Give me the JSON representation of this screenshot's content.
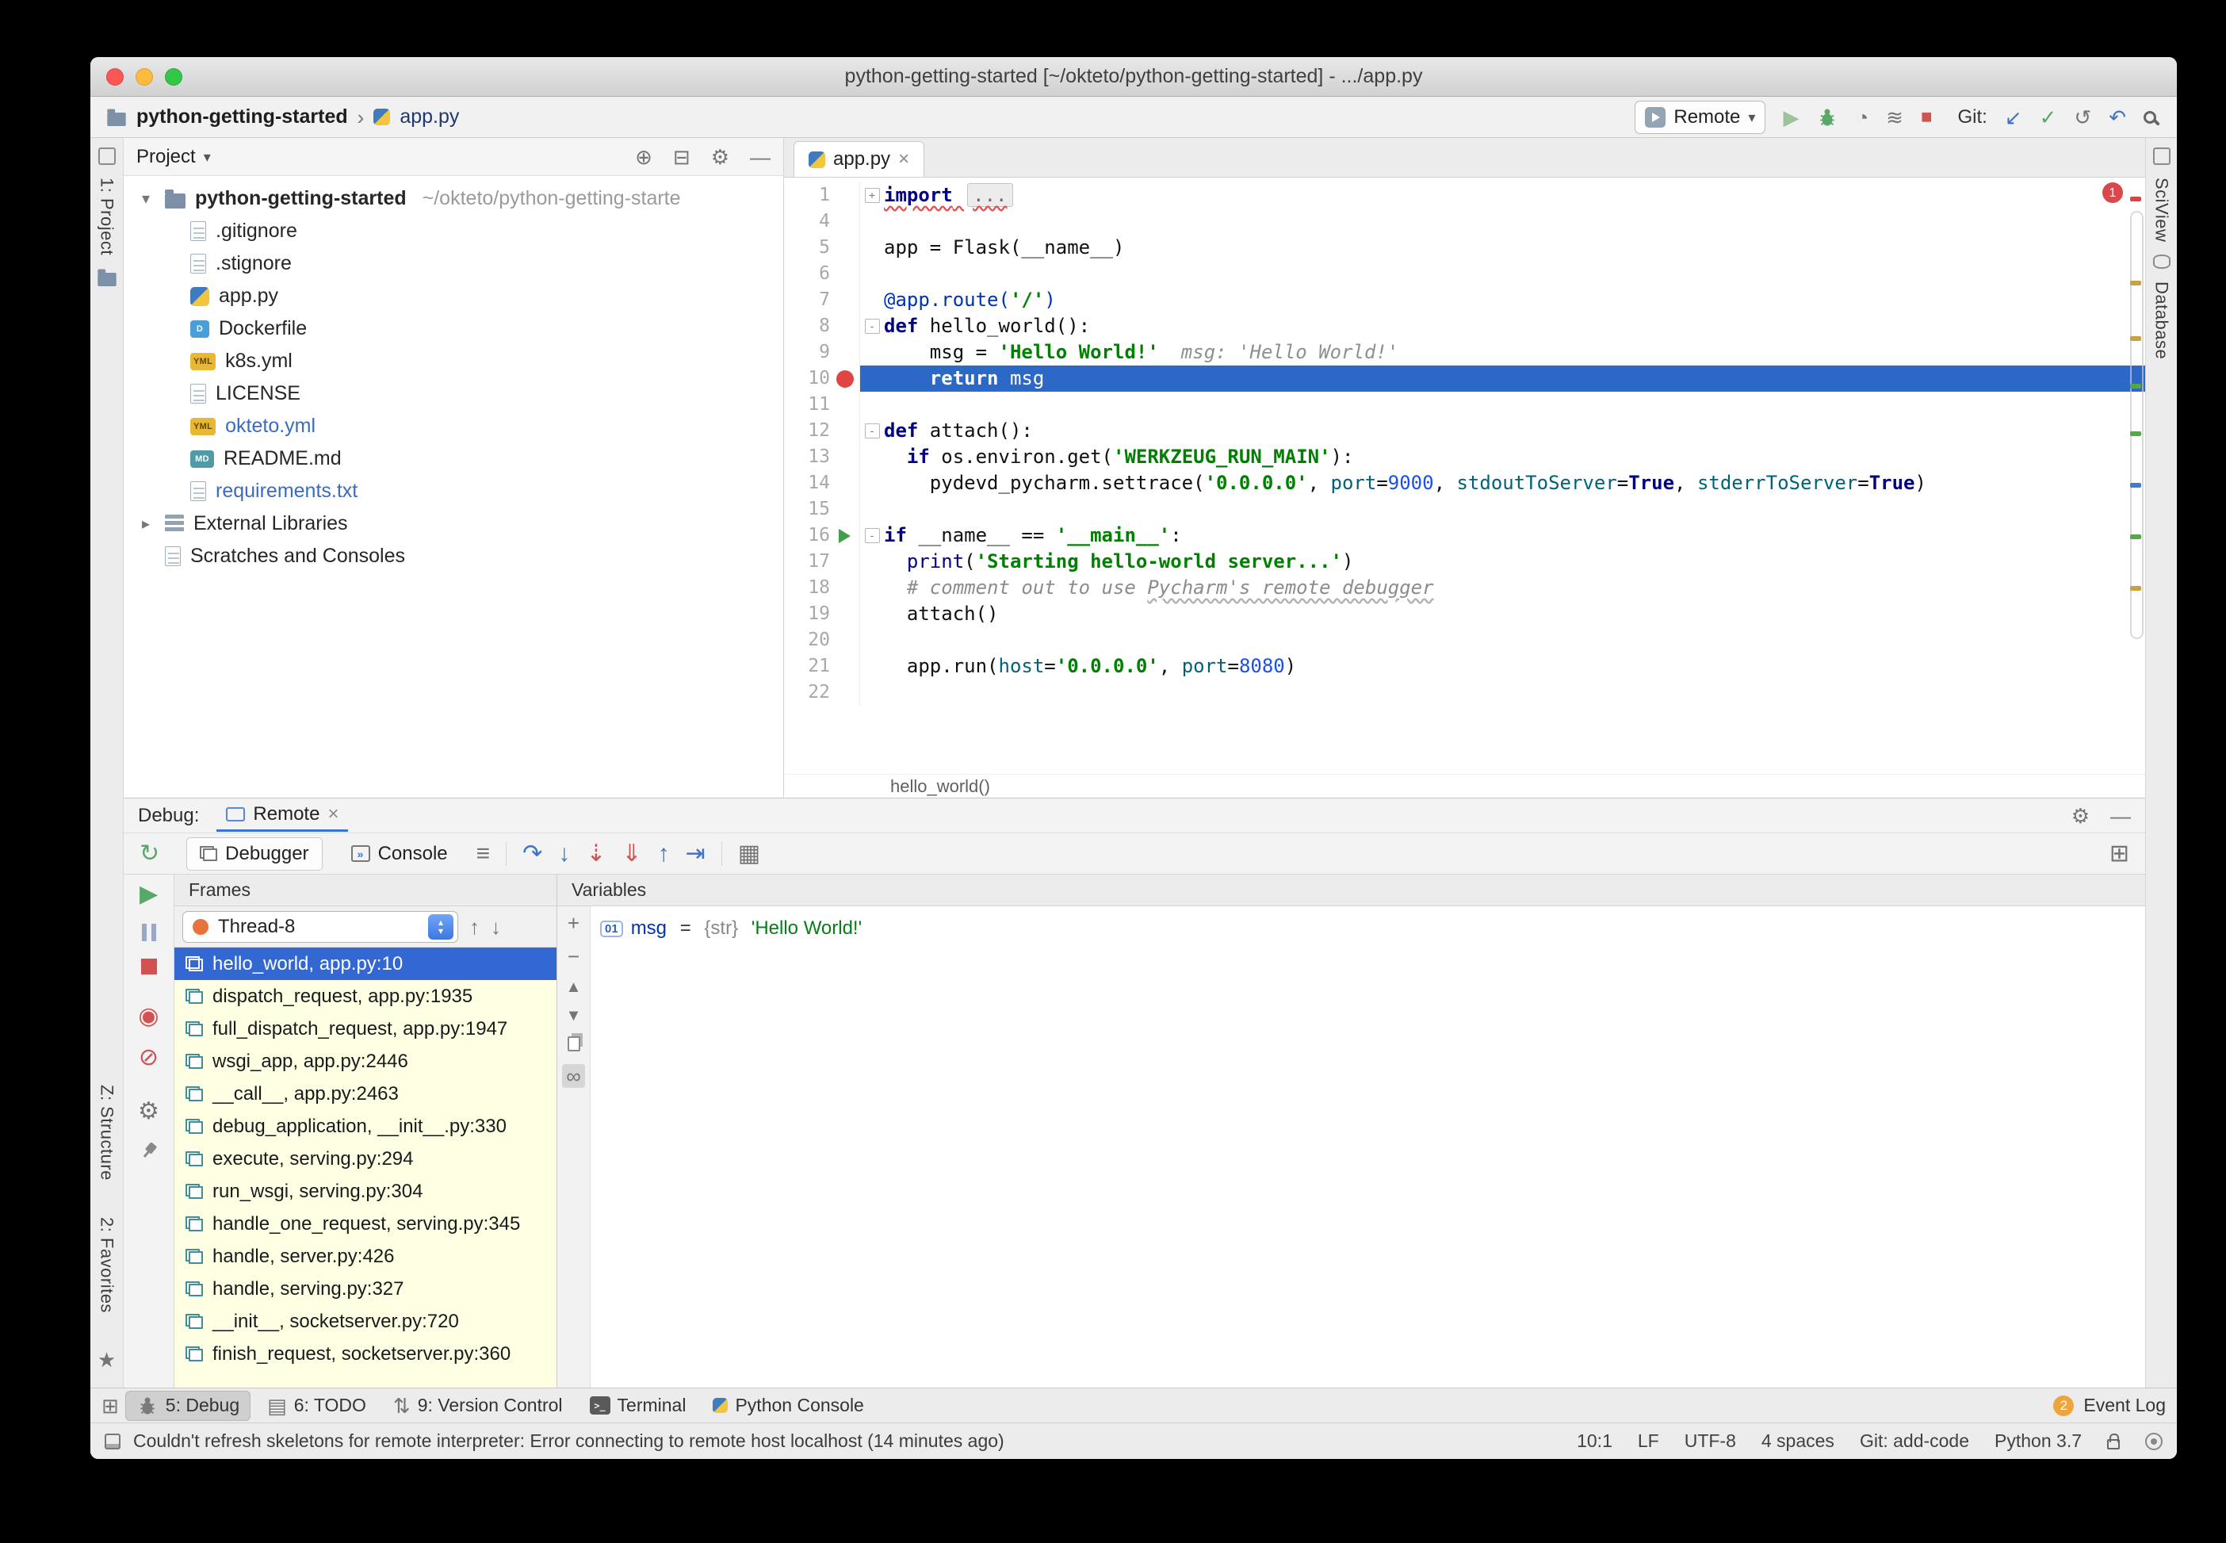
{
  "window": {
    "title": "python-getting-started [~/okteto/python-getting-started] - .../app.py"
  },
  "toolbar": {
    "project_crumb": "python-getting-started",
    "file_crumb": "app.py",
    "run_config": "Remote",
    "git_label": "Git:"
  },
  "stripes": {
    "project": "1: Project",
    "structure": "Z: Structure",
    "favorites": "2: Favorites",
    "sciview": "SciView",
    "database": "Database"
  },
  "project_panel": {
    "header": "Project",
    "root_name": "python-getting-started",
    "root_path": "~/okteto/python-getting-starte",
    "files": [
      {
        "name": ".gitignore",
        "icon": "file",
        "mod": false
      },
      {
        "name": ".stignore",
        "icon": "file",
        "mod": false
      },
      {
        "name": "app.py",
        "icon": "python",
        "mod": false
      },
      {
        "name": "Dockerfile",
        "icon": "docker",
        "mod": false
      },
      {
        "name": "k8s.yml",
        "icon": "yml",
        "mod": false
      },
      {
        "name": "LICENSE",
        "icon": "file",
        "mod": false
      },
      {
        "name": "okteto.yml",
        "icon": "yml",
        "mod": true
      },
      {
        "name": "README.md",
        "icon": "md",
        "mod": false
      },
      {
        "name": "requirements.txt",
        "icon": "file",
        "mod": true
      }
    ],
    "special": [
      {
        "name": "External Libraries",
        "icon": "lib",
        "arrow": true
      },
      {
        "name": "Scratches and Consoles",
        "icon": "scratch",
        "arrow": false
      }
    ]
  },
  "editor": {
    "tab": "app.py",
    "breadcrumb": "hello_world()",
    "error_badge": "1",
    "lines": [
      {
        "n": "1",
        "fold": "+",
        "segs": [
          [
            "import",
            "kw err"
          ],
          [
            " ",
            "err"
          ],
          [
            "...",
            "foldtxt err"
          ]
        ]
      },
      {
        "n": "4",
        "segs": []
      },
      {
        "n": "5",
        "segs": [
          [
            "app = Flask(__name__)",
            "plain"
          ]
        ]
      },
      {
        "n": "6",
        "segs": []
      },
      {
        "n": "7",
        "segs": [
          [
            "@app.route(",
            "dec"
          ],
          [
            "'/'",
            "str"
          ],
          [
            ")",
            "dec"
          ]
        ]
      },
      {
        "n": "8",
        "fold": "-",
        "segs": [
          [
            "def",
            "kw"
          ],
          [
            " hello_world():",
            "plain"
          ]
        ]
      },
      {
        "n": "9",
        "segs": [
          [
            "    msg = ",
            "plain"
          ],
          [
            "'Hello World!'",
            "str"
          ],
          [
            "msg: 'Hello World!'",
            "hint"
          ]
        ]
      },
      {
        "n": "10",
        "hl": true,
        "bp": true,
        "segs": [
          [
            "    ",
            "plain"
          ],
          [
            "return",
            "kw"
          ],
          [
            " msg",
            "plain"
          ]
        ]
      },
      {
        "n": "11",
        "segs": []
      },
      {
        "n": "12",
        "fold": "-",
        "segs": [
          [
            "def",
            "kw"
          ],
          [
            " attach():",
            "plain"
          ]
        ]
      },
      {
        "n": "13",
        "segs": [
          [
            "  ",
            "plain"
          ],
          [
            "if",
            "kw"
          ],
          [
            " os.environ.get(",
            "plain"
          ],
          [
            "'WERKZEUG_RUN_MAIN'",
            "str"
          ],
          [
            "):",
            "plain"
          ]
        ]
      },
      {
        "n": "14",
        "segs": [
          [
            "    pydevd_pycharm.settrace(",
            "plain"
          ],
          [
            "'0.0.0.0'",
            "str"
          ],
          [
            ", ",
            "plain"
          ],
          [
            "port",
            "prm"
          ],
          [
            "=",
            "plain"
          ],
          [
            "9000",
            "num"
          ],
          [
            ", ",
            "plain"
          ],
          [
            "stdoutToServer",
            "prm"
          ],
          [
            "=",
            "plain"
          ],
          [
            "True",
            "kw"
          ],
          [
            ", ",
            "plain"
          ],
          [
            "stderrToServer",
            "prm"
          ],
          [
            "=",
            "plain"
          ],
          [
            "True",
            "kw"
          ],
          [
            ")",
            "plain"
          ]
        ]
      },
      {
        "n": "15",
        "segs": []
      },
      {
        "n": "16",
        "fold": "-",
        "run": true,
        "segs": [
          [
            "if",
            "kw"
          ],
          [
            " __name__ == ",
            "plain"
          ],
          [
            "'__main__'",
            "str"
          ],
          [
            ":",
            "plain"
          ]
        ]
      },
      {
        "n": "17",
        "segs": [
          [
            "  ",
            "plain"
          ],
          [
            "print",
            "bi"
          ],
          [
            "(",
            "plain"
          ],
          [
            "'Starting hello-world server...'",
            "str"
          ],
          [
            ")",
            "plain"
          ]
        ]
      },
      {
        "n": "18",
        "segs": [
          [
            "  # comment out to use ",
            "com"
          ],
          [
            "Pycharm's remote debugger",
            "com typo"
          ]
        ]
      },
      {
        "n": "19",
        "segs": [
          [
            "  attach()",
            "plain"
          ]
        ]
      },
      {
        "n": "20",
        "segs": []
      },
      {
        "n": "21",
        "segs": [
          [
            "  app.run(",
            "plain"
          ],
          [
            "host",
            "prm"
          ],
          [
            "=",
            "plain"
          ],
          [
            "'0.0.0.0'",
            "str"
          ],
          [
            ", ",
            "plain"
          ],
          [
            "port",
            "prm"
          ],
          [
            "=",
            "plain"
          ],
          [
            "8080",
            "num"
          ],
          [
            ")",
            "plain"
          ]
        ]
      },
      {
        "n": "22",
        "segs": []
      }
    ]
  },
  "debug": {
    "label": "Debug:",
    "tab": "Remote",
    "tabs": [
      {
        "label": "Debugger"
      },
      {
        "label": "Console"
      }
    ],
    "frames_header": "Frames",
    "variables_header": "Variables",
    "thread": "Thread-8",
    "frames": [
      {
        "text": "hello_world, app.py:10",
        "selected": true
      },
      {
        "text": "dispatch_request, app.py:1935",
        "selected": false
      },
      {
        "text": "full_dispatch_request, app.py:1947",
        "selected": false
      },
      {
        "text": "wsgi_app, app.py:2446",
        "selected": false
      },
      {
        "text": "__call__, app.py:2463",
        "selected": false
      },
      {
        "text": "debug_application, __init__.py:330",
        "selected": false
      },
      {
        "text": "execute, serving.py:294",
        "selected": false
      },
      {
        "text": "run_wsgi, serving.py:304",
        "selected": false
      },
      {
        "text": "handle_one_request, serving.py:345",
        "selected": false
      },
      {
        "text": "handle, server.py:426",
        "selected": false
      },
      {
        "text": "handle, serving.py:327",
        "selected": false
      },
      {
        "text": "__init__, socketserver.py:720",
        "selected": false
      },
      {
        "text": "finish_request, socketserver.py:360",
        "selected": false
      }
    ],
    "variable": {
      "badge": "01",
      "name": "msg",
      "eq": " = ",
      "type": "{str} ",
      "value": "'Hello World!'"
    }
  },
  "toolwindow_bar": {
    "items": [
      {
        "label": "5: Debug",
        "icon": "bug",
        "active": true
      },
      {
        "label": "6: TODO",
        "icon": "todo",
        "active": false
      },
      {
        "label": "9: Version Control",
        "icon": "vcs",
        "active": false
      },
      {
        "label": "Terminal",
        "icon": "terminal",
        "active": false
      },
      {
        "label": "Python Console",
        "icon": "python",
        "active": false
      }
    ],
    "event_log": {
      "badge": "2",
      "label": "Event Log"
    }
  },
  "status_bar": {
    "message": "Couldn't refresh skeletons for remote interpreter: Error connecting to remote host localhost (14 minutes ago)",
    "items": [
      "10:1",
      "LF",
      "UTF-8",
      "4 spaces",
      "Git: add-code",
      "Python 3.7"
    ]
  },
  "icons": {
    "caret_down": "▾",
    "chevron": "›",
    "close": "×",
    "gear": "⚙",
    "hide": "—",
    "locate": "⊕",
    "collapse": "⊟",
    "run": "▶",
    "stop": "■",
    "rerun": "↻",
    "step_over": "↷",
    "step_into": "↓",
    "step_my_code": "⇣",
    "force_step": "⇓",
    "step_out": "↑",
    "run_to_cursor": "⇥",
    "evaluate": "▦",
    "menu": "≡",
    "layout": "⊞",
    "git_update": "↙",
    "git_commit": "✓",
    "git_history": "↺",
    "git_rollback": "↶",
    "up": "↑",
    "down": "↓",
    "plus": "+",
    "minus": "−",
    "tri_up": "▲",
    "tri_down": "▼",
    "glasses": "∞",
    "star": "★",
    "window": "⊞",
    "vcs": "⇅",
    "todo": "▤",
    "mute": "⊘",
    "breakpoints": "◉",
    "coverage": "◔",
    "profiler": "≋"
  },
  "colors": {
    "exec_line": "#2c68c5",
    "selection": "#3367d1",
    "frames_bg": "#ffffe4",
    "breakpoint": "#e04544",
    "event_badge": "#eda53c",
    "error_underline": "#e35252",
    "modified_file": "#3b6bbf",
    "kw": "#000080",
    "str": "#008000",
    "num": "#1750eb",
    "comment": "#8c8c8c",
    "param": "#00627a",
    "decorator": "#0033b3",
    "traffic_red": "#fc5753",
    "traffic_yellow": "#fdbc40",
    "traffic_green": "#33c748"
  }
}
